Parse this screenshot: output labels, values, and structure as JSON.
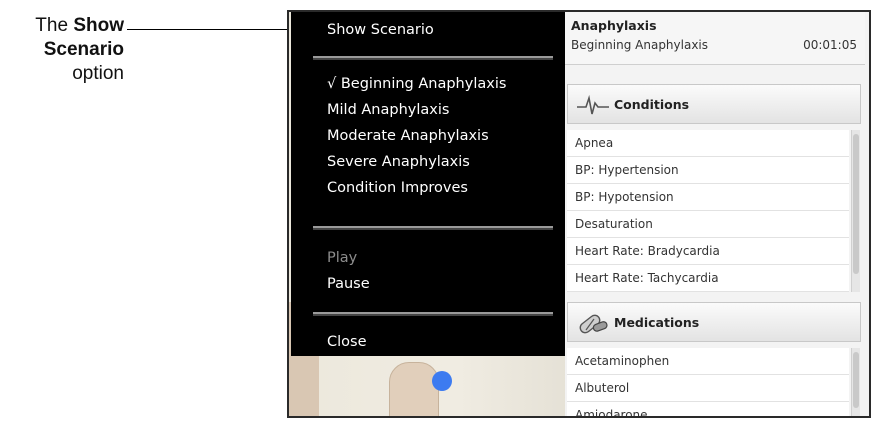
{
  "callout": {
    "prefix": "The",
    "bold_line1": "Show",
    "bold_line2": "Scenario",
    "suffix": "option"
  },
  "menu": {
    "show_scenario": "Show Scenario",
    "scenarios": [
      {
        "label": "√ Beginning Anaphylaxis",
        "checked": true
      },
      {
        "label": "Mild Anaphylaxis"
      },
      {
        "label": "Moderate Anaphylaxis"
      },
      {
        "label": "Severe Anaphylaxis"
      },
      {
        "label": "Condition Improves"
      }
    ],
    "play": "Play",
    "pause": "Pause",
    "close": "Close"
  },
  "scenario": {
    "title": "Anaphylaxis",
    "current": "Beginning Anaphylaxis",
    "time": "00:01:05"
  },
  "conditions": {
    "header": "Conditions",
    "icon": "ecg-waveform-icon",
    "items": [
      "Apnea",
      "BP: Hypertension",
      "BP: Hypotension",
      "Desaturation",
      "Heart Rate: Bradycardia",
      "Heart Rate: Tachycardia"
    ]
  },
  "medications": {
    "header": "Medications",
    "icon": "pills-icon",
    "items": [
      "Acetaminophen",
      "Albuterol",
      "Amiodarone"
    ]
  },
  "colors": {
    "menu_bg": "#000000",
    "indicator_dot": "#3d7bf0"
  }
}
